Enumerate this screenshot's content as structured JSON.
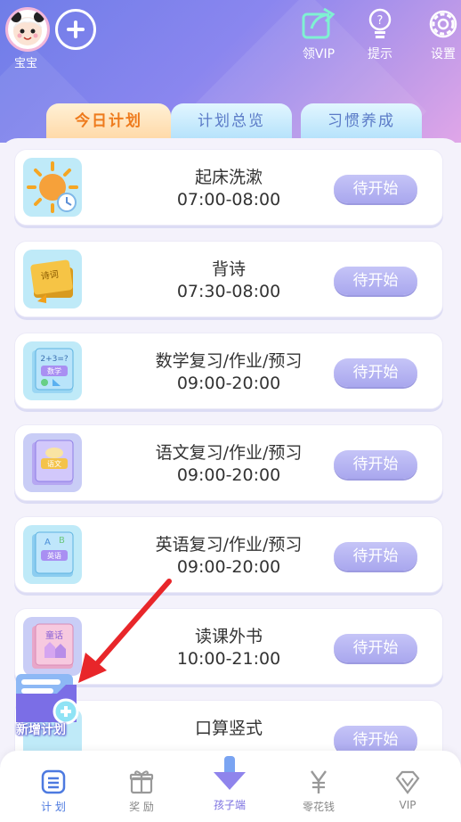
{
  "header": {
    "avatar_name": "宝宝",
    "vip_label": "领VIP",
    "hint_label": "提示",
    "settings_label": "设置"
  },
  "tabs": [
    {
      "label": "今日计划",
      "active": true
    },
    {
      "label": "计划总览",
      "active": false
    },
    {
      "label": "习惯养成",
      "active": false
    }
  ],
  "plans": [
    {
      "title": "起床洗漱",
      "time": "07:00-08:00",
      "status": "待开始",
      "icon": "sun-clock-icon"
    },
    {
      "title": "背诗",
      "time": "07:30-08:00",
      "status": "待开始",
      "icon": "poetry-book-icon"
    },
    {
      "title": "数学复习/作业/预习",
      "time": "09:00-20:00",
      "status": "待开始",
      "icon": "math-book-icon"
    },
    {
      "title": "语文复习/作业/预习",
      "time": "09:00-20:00",
      "status": "待开始",
      "icon": "chinese-book-icon"
    },
    {
      "title": "英语复习/作业/预习",
      "time": "09:00-20:00",
      "status": "待开始",
      "icon": "english-book-icon"
    },
    {
      "title": "读课外书",
      "time": "10:00-21:00",
      "status": "待开始",
      "icon": "storybook-icon"
    },
    {
      "title": "口算竖式",
      "time": "",
      "status": "待开始",
      "icon": "calc-book-icon"
    }
  ],
  "icon_text": {
    "poetry": "诗词",
    "math_top": "2+3=?",
    "math": "数学",
    "chinese": "语文",
    "english": "英语",
    "story": "童话"
  },
  "float_button": {
    "label": "新增计划"
  },
  "nav": [
    {
      "label": "计 划",
      "active": true
    },
    {
      "label": "奖 励",
      "active": false
    },
    {
      "label": "孩子端",
      "active": false
    },
    {
      "label": "零花钱",
      "active": false
    },
    {
      "label": "VIP",
      "active": false
    }
  ],
  "colors": {
    "accent": "#4d7ae0",
    "status_button": "#b5b3f2",
    "today_tab_text": "#ee7a1c"
  }
}
